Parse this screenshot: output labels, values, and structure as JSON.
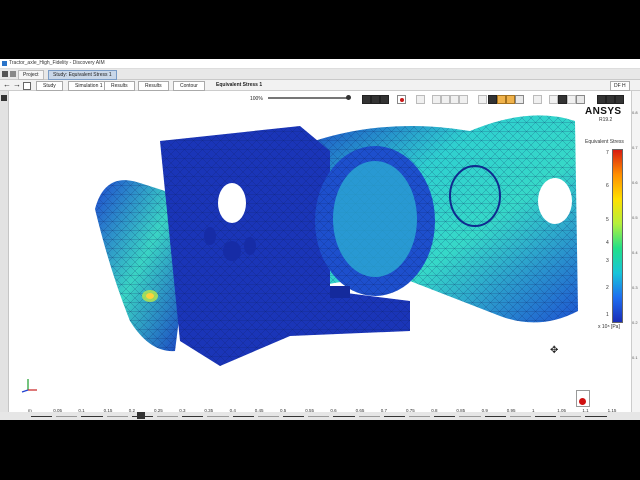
{
  "window": {
    "title": "Tractor_axle_High_Fidelity - Discovery AIM"
  },
  "tabs": [
    {
      "label": "Project"
    },
    {
      "label": "Study: Equivalent Stress 1"
    }
  ],
  "navigation": {
    "back_icon": "back-arrow-icon",
    "forward_icon": "forward-arrow-icon",
    "breadcrumbs": [
      {
        "label": "Study"
      },
      {
        "label": "Simulation 1"
      },
      {
        "label": "Results"
      },
      {
        "label": "Results"
      },
      {
        "label": "Contour"
      },
      {
        "label": "Equivalent Stress 1"
      }
    ],
    "right_label": "DF H"
  },
  "toolbar": {
    "zoom_level": "100%",
    "playback_icons": [
      "play-icon",
      "stop-icon",
      "step-icon"
    ],
    "record_icon": "record-icon"
  },
  "legend": {
    "brand": "ANSYS",
    "revision": "R19.2",
    "title": "Equivalent Stress",
    "ticks": [
      "7",
      "6",
      "5",
      "4",
      "3",
      "2",
      "1"
    ],
    "unit": "x 10⁸ [Pa]",
    "colors": [
      "#d81b10",
      "#ff8f00",
      "#ffe000",
      "#b4f03c",
      "#22e089",
      "#18c5d8",
      "#1e6ef0",
      "#1a2db8"
    ]
  },
  "right_strip_labels": [
    "0.8",
    "0.7",
    "0.6",
    "0.5",
    "0.4",
    "0.3",
    "0.2",
    "0.1"
  ],
  "ruler": {
    "labels": [
      "m",
      "0.05",
      "0.1",
      "0.15",
      "0.2",
      "0.25",
      "0.3",
      "0.35",
      "0.4",
      "0.45",
      "0.5",
      "0.55",
      "0.6",
      "0.65",
      "0.7",
      "0.75",
      "0.8",
      "0.85",
      "0.9",
      "0.95",
      "1",
      "1.05",
      "1.1",
      "1.15"
    ]
  },
  "status": {
    "warning_icon": "warning-icon"
  }
}
